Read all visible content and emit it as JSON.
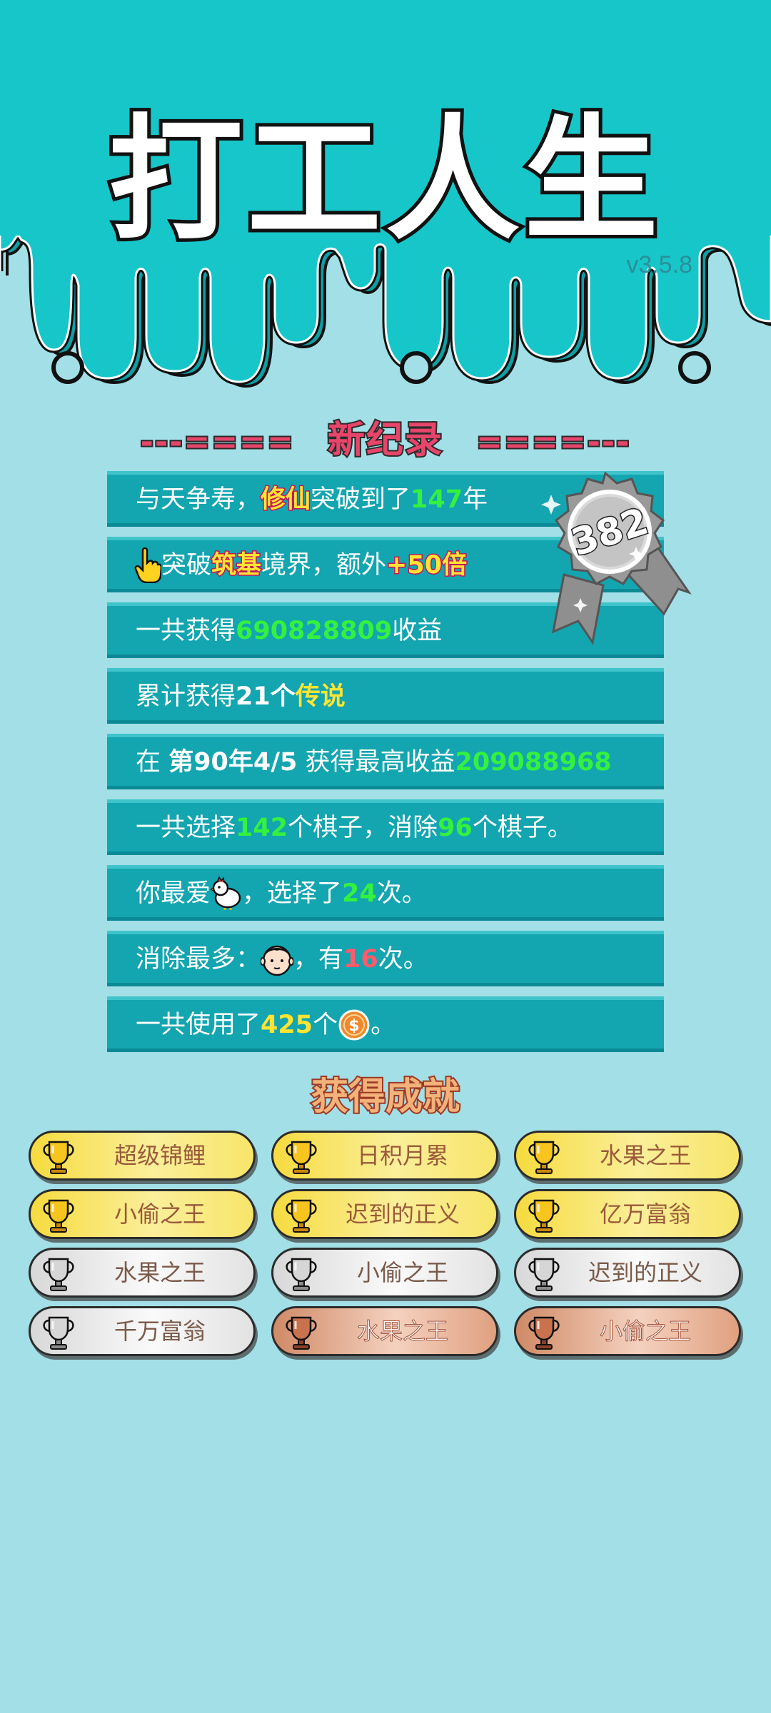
{
  "header": {
    "title": "打工人生",
    "version": "v3.5.8"
  },
  "record": {
    "left_deco": "---====",
    "title": "新纪录",
    "right_deco": "====---"
  },
  "badge": {
    "value": "382"
  },
  "stats": [
    {
      "parts": [
        {
          "t": "与天争寿，"
        },
        {
          "t": "修仙",
          "c": "hl"
        },
        {
          "t": "突破到了"
        },
        {
          "t": "147",
          "c": "g"
        },
        {
          "t": "年"
        }
      ]
    },
    {
      "icon": "pointing-hand-icon",
      "parts": [
        {
          "t": "突破"
        },
        {
          "t": "筑基",
          "c": "hl"
        },
        {
          "t": "境界，额外"
        },
        {
          "t": "+50倍",
          "c": "hl"
        }
      ]
    },
    {
      "parts": [
        {
          "t": "一共获得"
        },
        {
          "t": "690828809",
          "c": "g"
        },
        {
          "t": "收益"
        }
      ]
    },
    {
      "parts": [
        {
          "t": "累计获得"
        },
        {
          "t": "21个",
          "c": "b"
        },
        {
          "t": " "
        },
        {
          "t": "传说",
          "c": "y"
        }
      ]
    },
    {
      "parts": [
        {
          "t": "在 "
        },
        {
          "t": "第90年4/5",
          "c": "b"
        },
        {
          "t": " 获得最高收益"
        },
        {
          "t": "209088968",
          "c": "g"
        }
      ]
    },
    {
      "parts": [
        {
          "t": "一共选择"
        },
        {
          "t": "142",
          "c": "g"
        },
        {
          "t": "个棋子，消除"
        },
        {
          "t": "96",
          "c": "g"
        },
        {
          "t": "个棋子。"
        }
      ]
    },
    {
      "parts": [
        {
          "t": "你最爱"
        },
        {
          "icon": "chicken-icon"
        },
        {
          "t": "，选择了"
        },
        {
          "t": "24",
          "c": "g"
        },
        {
          "t": "次。"
        }
      ]
    },
    {
      "parts": [
        {
          "t": "消除最多："
        },
        {
          "icon": "man-face-icon"
        },
        {
          "t": "，有"
        },
        {
          "t": "16",
          "c": "r"
        },
        {
          "t": "次。"
        }
      ]
    },
    {
      "parts": [
        {
          "t": "一共使用了"
        },
        {
          "t": "425",
          "c": "y"
        },
        {
          "t": "个"
        },
        {
          "icon": "coin-icon"
        },
        {
          "t": "。"
        }
      ]
    }
  ],
  "achievements": {
    "title": "获得成就",
    "items": [
      {
        "label": "超级锦鲤",
        "tier": "gold"
      },
      {
        "label": "日积月累",
        "tier": "gold"
      },
      {
        "label": "水果之王",
        "tier": "gold"
      },
      {
        "label": "小偷之王",
        "tier": "gold"
      },
      {
        "label": "迟到的正义",
        "tier": "gold"
      },
      {
        "label": "亿万富翁",
        "tier": "gold"
      },
      {
        "label": "水果之王",
        "tier": "silver"
      },
      {
        "label": "小偷之王",
        "tier": "silver"
      },
      {
        "label": "迟到的正义",
        "tier": "silver"
      },
      {
        "label": "千万富翁",
        "tier": "silver"
      },
      {
        "label": "水果之王",
        "tier": "bronze"
      },
      {
        "label": "小偷之王",
        "tier": "bronze"
      }
    ]
  },
  "colors": {
    "header_bg": "#17c6c9",
    "body_bg": "#a3dfe6",
    "row_bg": "#13a5b0",
    "accent_green": "#35f13f",
    "accent_yellow": "#ffe433",
    "accent_red": "#ff5a6b",
    "record_pink": "#e8456b"
  }
}
